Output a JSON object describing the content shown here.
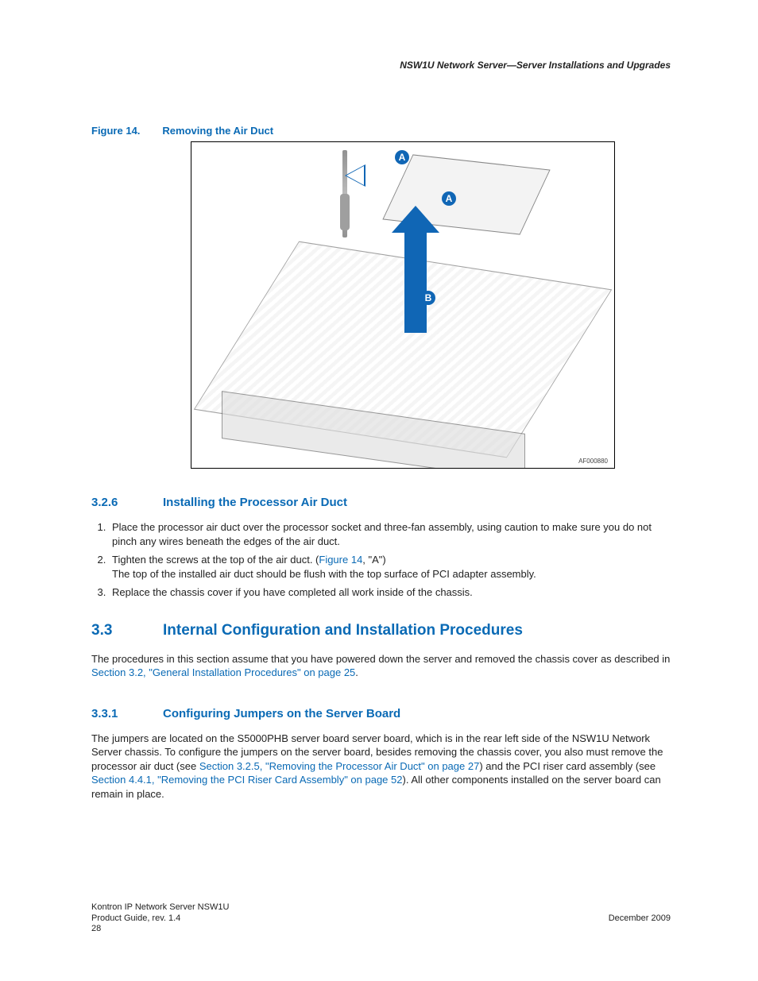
{
  "header": {
    "running_title": "NSW1U Network Server—Server Installations and Upgrades"
  },
  "figure": {
    "label": "Figure 14.",
    "title": "Removing the Air Duct",
    "image_id": "AF000880",
    "callouts": {
      "a": "A",
      "a2": "A",
      "b": "B"
    }
  },
  "section_326": {
    "num": "3.2.6",
    "title": "Installing the Processor Air Duct",
    "steps": [
      {
        "text": "Place the processor air duct over the processor socket and three-fan assembly, using caution to make sure you do not pinch any wires beneath the edges of the air duct."
      },
      {
        "pre": "Tighten the screws at the top of the air duct. (",
        "xref": "Figure 14",
        "mid": ", \"A\")",
        "line2": "The top of the installed air duct should be flush with the top surface of PCI adapter assembly."
      },
      {
        "text": "Replace the chassis cover if you have completed all work inside of the chassis."
      }
    ]
  },
  "section_33": {
    "num": "3.3",
    "title": "Internal Configuration and Installation Procedures",
    "para_pre": "The procedures in this section assume that you have powered down the server and removed the chassis cover as described in ",
    "para_xref": "Section 3.2, \"General Installation Procedures\" on page 25",
    "para_post": "."
  },
  "section_331": {
    "num": "3.3.1",
    "title": "Configuring Jumpers on the Server Board",
    "p1": "The jumpers are located on the S5000PHB server board server board, which is in the rear left side of the NSW1U Network Server chassis. To configure the jumpers on the server board, besides removing the chassis cover, you also must remove the processor air duct (see ",
    "xref1": "Section 3.2.5, \"Removing the Processor Air Duct\" on page 27",
    "p2": ") and the PCI riser card assembly (see ",
    "xref2": "Section 4.4.1, \"Removing the PCI Riser Card Assembly\" on page 52",
    "p3": "). All other components installed on the server board can remain in place."
  },
  "footer": {
    "line1": "Kontron IP Network Server NSW1U",
    "line2": "Product Guide, rev. 1.4",
    "page": "28",
    "date": "December 2009"
  }
}
